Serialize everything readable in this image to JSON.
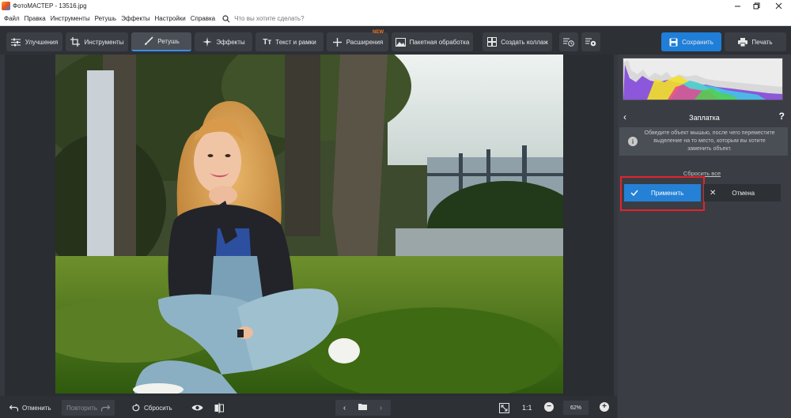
{
  "window": {
    "title": "ФотоМАСТЕР - 13516.jpg",
    "controls": [
      "minimize",
      "maximize",
      "close"
    ]
  },
  "menu": {
    "items": [
      "Файл",
      "Правка",
      "Инструменты",
      "Ретушь",
      "Эффекты",
      "Настройки",
      "Справка"
    ],
    "search_placeholder": "Что вы хотите сделать?"
  },
  "toolbar": {
    "tabs": [
      {
        "label": "Улучшения",
        "icon": "sliders-icon"
      },
      {
        "label": "Инструменты",
        "icon": "crop-icon"
      },
      {
        "label": "Ретушь",
        "icon": "brush-icon",
        "active": true
      },
      {
        "label": "Эффекты",
        "icon": "sparkle-icon"
      },
      {
        "label": "Текст и рамки",
        "icon": "text-icon"
      },
      {
        "label": "Расширения",
        "icon": "plus-icon",
        "badge": "NEW"
      },
      {
        "label": "Пакетная обработка",
        "icon": "batch-icon"
      },
      {
        "label": "Создать коллаж",
        "icon": "collage-icon"
      }
    ],
    "save_label": "Сохранить",
    "print_label": "Печать"
  },
  "panel": {
    "title": "Заплатка",
    "help": "?",
    "info_text": "Обведите объект мышью, после чего переместите выделение на то место, которым вы хотите заменить объект.",
    "reset_all": "Сбросить все",
    "apply_label": "Применить",
    "cancel_label": "Отмена"
  },
  "bottom": {
    "undo_label": "Отменить",
    "redo_label": "Повторить",
    "reset_label": "Сбросить",
    "ratio_label": "1:1",
    "zoom": "62%"
  },
  "colors": {
    "accent": "#2481d6",
    "highlight_frame": "#e0252e",
    "new_badge": "#f07820",
    "toolbar_bg": "#2d3035",
    "panel_bg": "#3a3d43"
  }
}
